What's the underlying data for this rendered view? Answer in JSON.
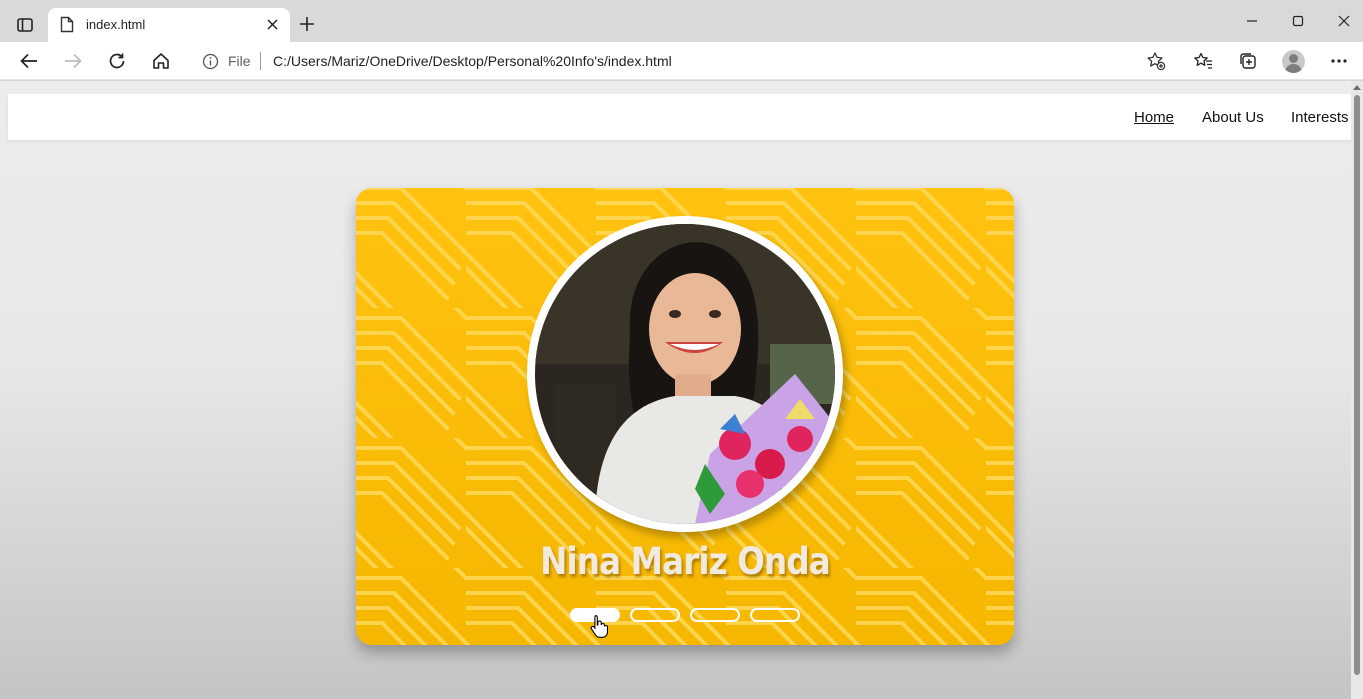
{
  "browser": {
    "tab": {
      "title": "index.html"
    },
    "address": {
      "scheme": "File",
      "url": "C:/Users/Mariz/OneDrive/Desktop/Personal%20Info's/index.html"
    },
    "icons": [
      "sidebar-icon",
      "page-icon",
      "close-icon",
      "plus-icon",
      "minimize-icon",
      "maximize-icon",
      "window-close-icon",
      "back-icon",
      "forward-icon",
      "refresh-icon",
      "home-icon",
      "info-icon",
      "add-favorite-icon",
      "favorites-icon",
      "collections-icon",
      "profile-icon",
      "more-icon"
    ]
  },
  "site": {
    "nav": [
      {
        "label": "Home",
        "active": true
      },
      {
        "label": "About Us",
        "active": false
      },
      {
        "label": "Interests",
        "active": false
      }
    ],
    "card": {
      "name": "Nina Mariz Onda",
      "accent": "#ffc107",
      "slides": 4,
      "active_slide": 1
    }
  }
}
